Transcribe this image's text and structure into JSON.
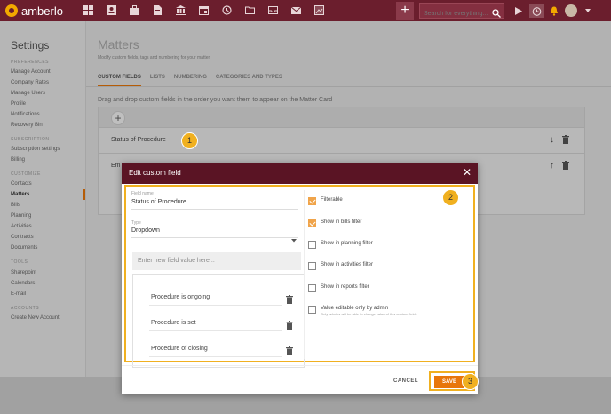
{
  "app": {
    "logo_text": "amberlo"
  },
  "topbar": {
    "nav_icons": [
      "dashboard-icon",
      "contacts-icon",
      "briefcase-icon",
      "document-icon",
      "bank-icon",
      "calendar-icon",
      "history-icon",
      "folder-icon",
      "box-icon",
      "mail-icon",
      "image-icon"
    ],
    "add_label": "+",
    "search_placeholder": "Search for everything..."
  },
  "sidebar": {
    "title": "Settings",
    "sections": [
      {
        "label": "PREFERENCES",
        "items": [
          "Manage Account",
          "Company Rates",
          "Manage Users",
          "Profile",
          "Notifications",
          "Recovery Bin"
        ]
      },
      {
        "label": "SUBSCRIPTION",
        "items": [
          "Subscription settings",
          "Billing"
        ]
      },
      {
        "label": "CUSTOMIZE",
        "items": [
          "Contacts",
          "Matters",
          "Bills",
          "Planning",
          "Activities",
          "Contracts",
          "Documents"
        ]
      },
      {
        "label": "TOOLS",
        "items": [
          "Sharepoint",
          "Calendars",
          "E-mail"
        ]
      },
      {
        "label": "ACCOUNTS",
        "items": [
          "Create New Account"
        ]
      }
    ],
    "active_item": "Matters"
  },
  "main": {
    "title": "Matters",
    "subtitle": "Modify custom fields, tags and numbering for your matter",
    "tabs": [
      "CUSTOM FIELDS",
      "LISTS",
      "NUMBERING",
      "CATEGORIES AND TYPES"
    ],
    "active_tab": "CUSTOM FIELDS",
    "instruction": "Drag and drop custom fields in the order you want them to appear on the Matter Card",
    "add_label": "+",
    "fields": [
      {
        "name": "Status of Procedure",
        "arrow": "↓"
      },
      {
        "name": "Em",
        "arrow": "↑"
      }
    ]
  },
  "modal": {
    "title": "Edit custom field",
    "close": "✕",
    "field_name_label": "Field name",
    "field_name_value": "Status of Procedure",
    "type_label": "Type",
    "type_value": "Dropdown",
    "new_value_placeholder": "Enter new field value here ..",
    "options": [
      "Procedure is ongoing",
      "Procedure is set",
      "Procedure of closing"
    ],
    "checkboxes": [
      {
        "label": "Filterable",
        "checked": true
      },
      {
        "label": "Show in bills filter",
        "checked": true
      },
      {
        "label": "Show in planning filter",
        "checked": false
      },
      {
        "label": "Show in activities filter",
        "checked": false
      },
      {
        "label": "Show in reports filter",
        "checked": false
      },
      {
        "label": "Value editable only by admin",
        "checked": false,
        "sub": "Only admins will be able to change value of this custom field."
      }
    ],
    "cancel": "CANCEL",
    "save": "SAVE"
  },
  "badges": [
    "1",
    "2",
    "3"
  ],
  "colors": {
    "topbar": "#6b1e2d",
    "accent": "#e8760a",
    "highlight": "#f0b020",
    "modal_header": "#5a1424"
  }
}
